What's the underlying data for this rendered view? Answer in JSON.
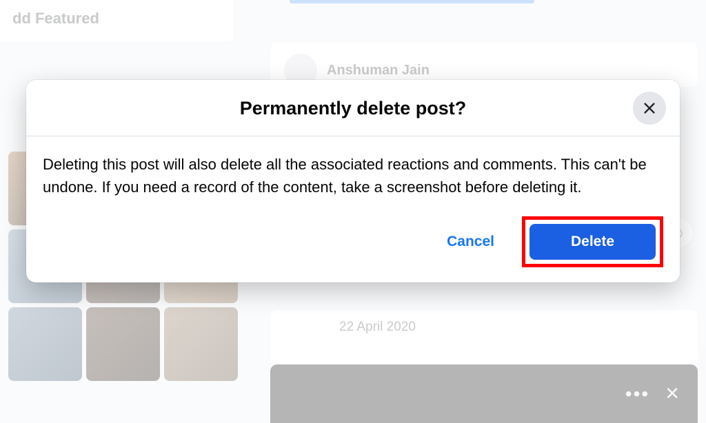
{
  "sidebar": {
    "featured_label": "dd Featured"
  },
  "post": {
    "author_name": "Anshuman Jain",
    "date_text": "22 April 2020"
  },
  "modal": {
    "title": "Permanently delete post?",
    "body_text": "Deleting this post will also delete all the associated reactions and comments. This can't be undone. If you need a record of the content, take a screenshot before deleting it.",
    "cancel_label": "Cancel",
    "delete_label": "Delete"
  },
  "icons": {
    "ellipsis": "•••",
    "close_small": "✕",
    "reaction": "☺"
  }
}
